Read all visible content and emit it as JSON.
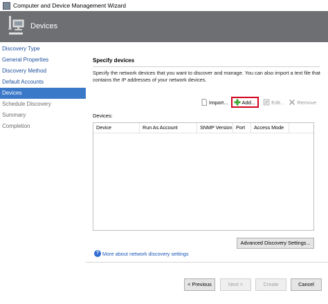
{
  "window": {
    "title": "Computer and Device Management Wizard"
  },
  "header": {
    "title": "Devices"
  },
  "nav": {
    "items": [
      {
        "label": "Discovery Type",
        "state": "done"
      },
      {
        "label": "General Properties",
        "state": "done"
      },
      {
        "label": "Discovery Method",
        "state": "done"
      },
      {
        "label": "Default Accounts",
        "state": "done"
      },
      {
        "label": "Devices",
        "state": "active"
      },
      {
        "label": "Schedule Discovery",
        "state": "future"
      },
      {
        "label": "Summary",
        "state": "future"
      },
      {
        "label": "Completion",
        "state": "future"
      }
    ]
  },
  "main": {
    "section_title": "Specify devices",
    "description": "Specify the network devices that you want to discover and manage. You can also import a text file that contains the IP addresses of your network devices.",
    "toolbar": {
      "import_label": "Import...",
      "add_label": "Add...",
      "edit_label": "Edit...",
      "remove_label": "Remove"
    },
    "devices_label": "Devices:",
    "columns": [
      "Device",
      "Run As Account",
      "SNMP Version",
      "Port",
      "Access Mode"
    ],
    "advanced_button": "Advanced Discovery Settings...",
    "help_link": "More about network discovery settings"
  },
  "footer": {
    "previous": "< Previous",
    "next": "Next >",
    "create": "Create",
    "cancel": "Cancel"
  },
  "colors": {
    "header_bg": "#6d6f72",
    "active_nav": "#3a78c8",
    "highlight": "#d0021b"
  }
}
